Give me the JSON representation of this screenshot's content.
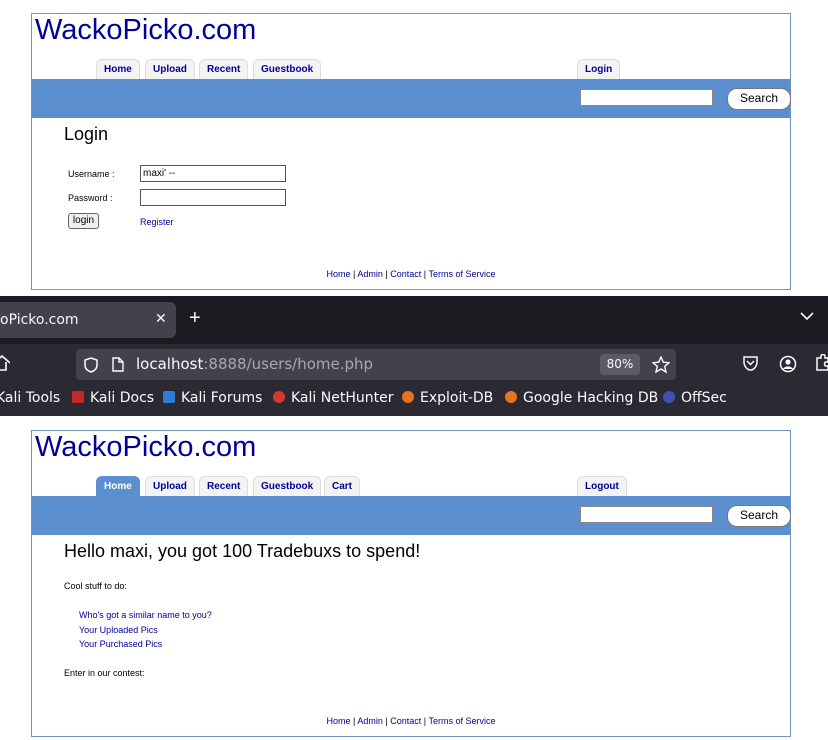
{
  "top_page": {
    "brand": "WackoPicko.com",
    "tabs": [
      "Home",
      "Upload",
      "Recent",
      "Guestbook"
    ],
    "right_tab": "Login",
    "search_button": "Search",
    "heading": "Login",
    "username_label": "Username :",
    "username_value": "maxi' --",
    "password_label": "Password :",
    "login_button": "login",
    "register_link": "Register",
    "footer": [
      "Home",
      "Admin",
      "Contact",
      "Terms of Service"
    ]
  },
  "browser": {
    "tab_title": "oPicko.com",
    "url_host": "localhost",
    "url_rest": ":8888/users/home.php",
    "zoom": "80%",
    "bookmarks": [
      "Kali Tools",
      "Kali Docs",
      "Kali Forums",
      "Kali NetHunter",
      "Exploit-DB",
      "Google Hacking DB",
      "OffSec"
    ],
    "bookmark_colors": [
      "#367bf0",
      "#c62828",
      "#2f7bd8",
      "#d23a2a",
      "#e8731f",
      "#e8731f",
      "#3f51b5"
    ]
  },
  "bottom_page": {
    "brand": "WackoPicko.com",
    "tabs": [
      "Home",
      "Upload",
      "Recent",
      "Guestbook",
      "Cart"
    ],
    "right_tab": "Logout",
    "search_button": "Search",
    "heading": "Hello maxi, you got 100 Tradebuxs to spend!",
    "cool_stuff": "Cool stuff to do:",
    "links": [
      "Who's got a similar name to you?",
      "Your Uploaded Pics",
      "Your Purchased Pics"
    ],
    "contest": "Enter in our contest:",
    "footer": [
      "Home",
      "Admin",
      "Contact",
      "Terms of Service"
    ]
  }
}
